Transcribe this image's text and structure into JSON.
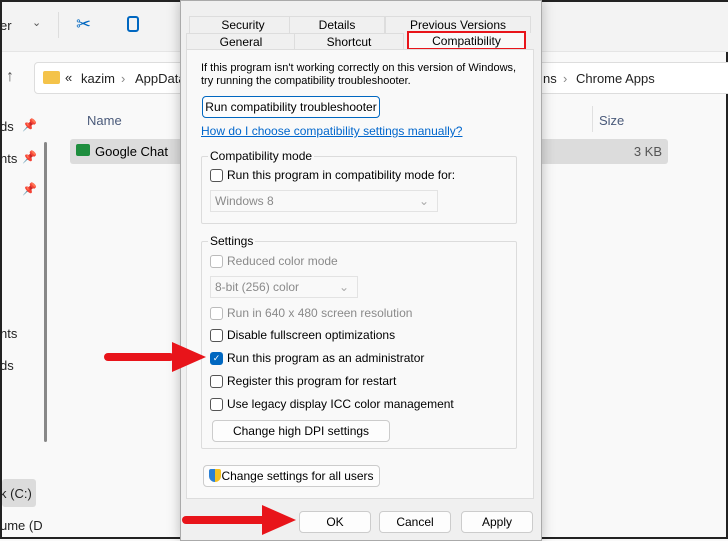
{
  "explorer": {
    "view_label": "er",
    "breadcrumb": {
      "root": "«",
      "items": [
        "kazim",
        "AppData",
        "ns",
        "Chrome Apps"
      ]
    },
    "columns": {
      "name": "Name",
      "size": "Size"
    },
    "file": {
      "name": "Google Chat",
      "size": "3 KB"
    },
    "sidebar": [
      "ds",
      "nts",
      "nts",
      "ds",
      "k (C:)",
      "ume (D"
    ]
  },
  "dialog": {
    "tabs_row1": [
      "Security",
      "Details",
      "Previous Versions"
    ],
    "tabs_row2": [
      "General",
      "Shortcut",
      "Compatibility"
    ],
    "active_tab": "Compatibility",
    "intro": "If this program isn't working correctly on this version of Windows, try running the compatibility troubleshooter.",
    "troubleshooter_button": "Run compatibility troubleshooter",
    "help_link": "How do I choose compatibility settings manually?",
    "compat_group": {
      "label": "Compatibility mode",
      "checkbox": "Run this program in compatibility mode for:",
      "checked": false,
      "select": "Windows 8"
    },
    "settings_group": {
      "label": "Settings",
      "reduced_color": "Reduced color mode",
      "color_select": "8-bit (256) color",
      "res640": "Run in 640 x 480 screen resolution",
      "fullscreen": "Disable fullscreen optimizations",
      "admin": "Run this program as an administrator",
      "admin_checked": true,
      "restart": "Register this program for restart",
      "icc": "Use legacy display ICC color management",
      "dpi_button": "Change high DPI settings"
    },
    "all_users_button": "Change settings for all users",
    "ok": "OK",
    "cancel": "Cancel",
    "apply": "Apply"
  },
  "colors": {
    "highlight": "#e8141a",
    "accent": "#0067c0",
    "link": "#0066cc"
  }
}
